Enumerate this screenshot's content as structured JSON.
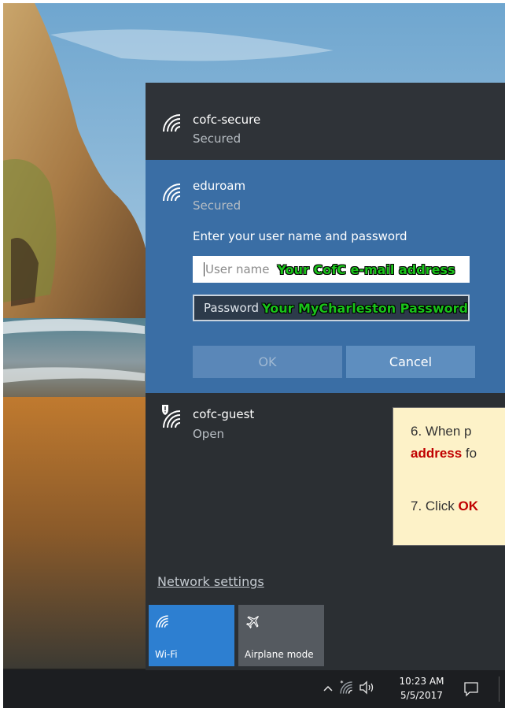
{
  "networks": [
    {
      "name": "cofc-secure",
      "status": "Secured"
    },
    {
      "name": "eduroam",
      "status": "Secured"
    },
    {
      "name": "cofc-guest",
      "status": "Open"
    }
  ],
  "eduroam_form": {
    "prompt": "Enter your user name and password",
    "username_placeholder": "User name",
    "username_hint": "Your CofC e-mail address",
    "password_placeholder": "Password",
    "password_hint": "Your MyCharleston Password",
    "ok_label": "OK",
    "cancel_label": "Cancel"
  },
  "network_settings_label": "Network settings",
  "quick_actions": [
    {
      "label": "Wi-Fi",
      "icon": "wifi-icon",
      "active": true
    },
    {
      "label": "Airplane mode",
      "icon": "airplane-icon",
      "active": false
    }
  ],
  "callout": {
    "step6_prefix": "6. When p",
    "step6_bold": "address",
    "step6_suffix": " fo",
    "step7_prefix": "7. Click ",
    "step7_bold": "OK"
  },
  "taskbar": {
    "time": "10:23 AM",
    "date": "5/5/2017",
    "tray_icons": [
      "chevron-up-icon",
      "wifi-icon",
      "speaker-icon",
      "action-center-icon"
    ]
  },
  "colors": {
    "selected_network_bg": "#3a6ea5",
    "flyout_bg": "#2b2f33",
    "hint_text": "#19c319",
    "callout_bg": "#fdf2c8",
    "callout_highlight": "#c00000",
    "wifi_tile_active": "#2d7fd1"
  }
}
